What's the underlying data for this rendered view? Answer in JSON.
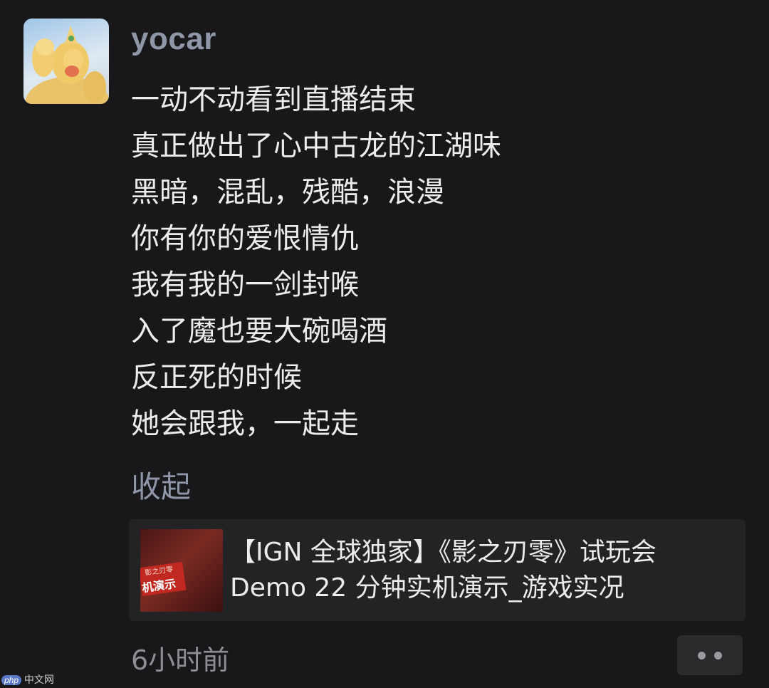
{
  "author": {
    "username": "yocar"
  },
  "post": {
    "lines": [
      "一动不动看到直播结束",
      "真正做出了心中古龙的江湖味",
      "黑暗，混乱，残酷，浪漫",
      "你有你的爱恨情仇",
      "我有我的一剑封喉",
      "入了魔也要大碗喝酒",
      "反正死的时候",
      "她会跟我，一起走"
    ],
    "collapse_label": "收起"
  },
  "link_card": {
    "title_line1": "【IGN 全球独家】《影之刃零》试玩会",
    "title_line2": " Demo 22 分钟实机演示_游戏实况",
    "thumbnail_text_small": "影之刃零",
    "thumbnail_text_large": "机演示"
  },
  "meta": {
    "timestamp": "6小时前"
  },
  "watermark": {
    "logo": "php",
    "text": "中文网"
  }
}
